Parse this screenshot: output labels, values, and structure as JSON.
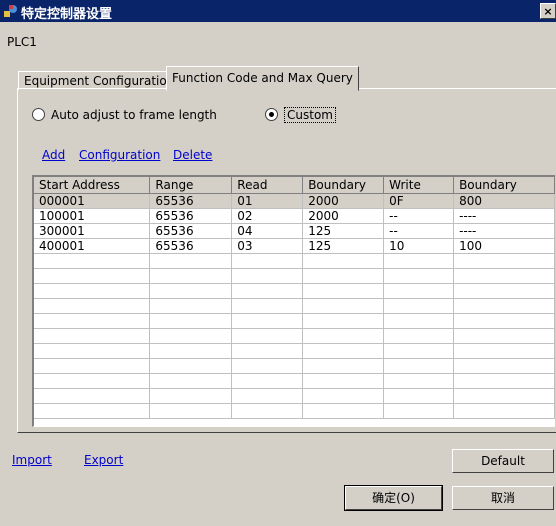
{
  "window": {
    "title": "特定控制器设置",
    "close_label": "×"
  },
  "device_name": "PLC1",
  "tabs": [
    {
      "label": "Equipment Configuration"
    },
    {
      "label": "Function Code and Max Query"
    }
  ],
  "mode": {
    "options": [
      {
        "label": "Auto adjust to frame length",
        "selected": false
      },
      {
        "label": "Custom",
        "selected": true
      }
    ]
  },
  "actions": {
    "add": "Add",
    "configuration": "Configuration",
    "delete": "Delete"
  },
  "table": {
    "columns": [
      "Start Address",
      "Range",
      "Read",
      "Boundary",
      "Write",
      "Boundary"
    ],
    "rows": [
      [
        "000001",
        "65536",
        "01",
        "2000",
        "0F",
        "800"
      ],
      [
        "100001",
        "65536",
        "02",
        "2000",
        "--",
        "----"
      ],
      [
        "300001",
        "65536",
        "04",
        "125",
        "--",
        "----"
      ],
      [
        "400001",
        "65536",
        "03",
        "125",
        "10",
        "100"
      ]
    ],
    "selected_row": 0
  },
  "footer": {
    "import": "Import",
    "export": "Export",
    "default": "Default"
  },
  "buttons": {
    "ok": "确定(O)",
    "cancel": "取消"
  }
}
